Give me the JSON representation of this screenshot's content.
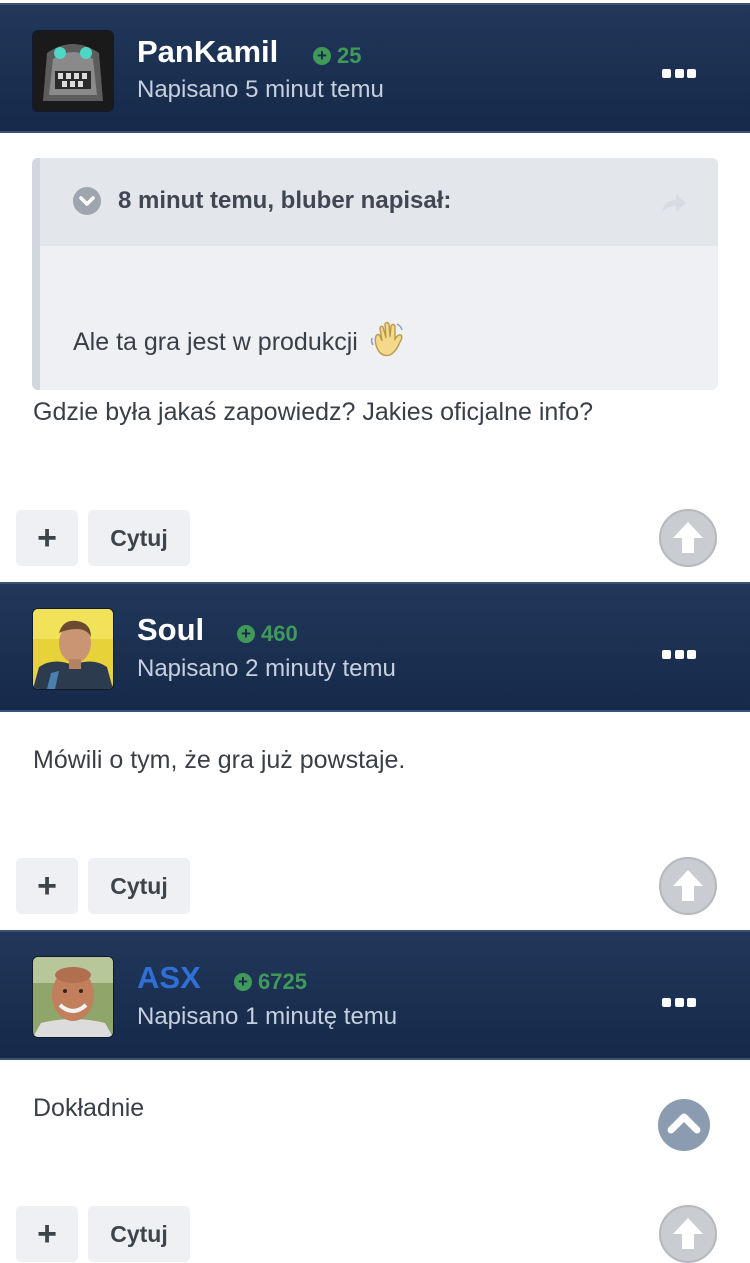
{
  "posts": [
    {
      "username": "PanKamil",
      "reputation": "25",
      "posted": "Napisano 5 minut temu",
      "quote": {
        "header": "8 minut temu, bluber napisał:",
        "text": "Ale ta gra jest w produkcji"
      },
      "text": "Gdzie była jakaś zapowiedz? Jakies oficjalne info?"
    },
    {
      "username": "Soul",
      "reputation": "460",
      "posted": "Napisano 2 minuty temu",
      "text": "Mówili o tym, że gra już powstaje."
    },
    {
      "username": "ASX",
      "reputation": "6725",
      "posted": "Napisano 1 minutę temu",
      "text": "Dokładnie"
    }
  ],
  "actions": {
    "plus_label": "+",
    "quote_label": "Cytuj"
  },
  "colors": {
    "header_bg": "#1b2f50",
    "reputation": "#3f9a5a",
    "moderator_name": "#2f6fd6"
  }
}
